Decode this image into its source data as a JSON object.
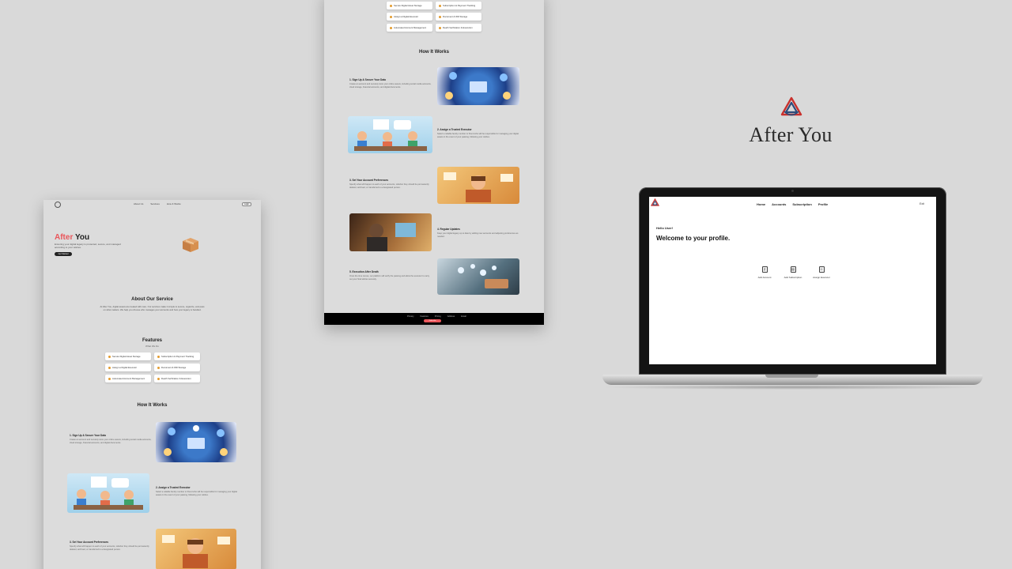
{
  "brand": {
    "name": "After You"
  },
  "site": {
    "nav": {
      "links": [
        "About Us",
        "Services",
        "How It Works"
      ],
      "button": "Login"
    },
    "hero": {
      "title_accent": "After",
      "title_rest": " You",
      "subtitle": "Ensuring your digital legacy is protected, secure, and managed according to your wishes.",
      "cta": "Get Started"
    },
    "about": {
      "title": "About Our Service",
      "text": "At After You, digital assets are treated with care. Our services make it simple to secure, organize, and pass on what matters. We help you choose who manages your accounts and how your legacy is handled."
    },
    "features": {
      "title": "Features",
      "subtitle": "What We Do",
      "items": [
        "Secure Digital Asset Storage",
        "Subscription & Payment Tracking",
        "Assign a Digital Executor",
        "Document & Will Storage",
        "Automated Account Management",
        "Death Verification & Execution"
      ]
    },
    "how": {
      "title": "How It Works",
      "steps": [
        {
          "title": "1. Sign Up & Secure Your Data",
          "desc": "Create an account and securely store your online assets, including social media accounts, cloud storage, financial accounts, and digital documents."
        },
        {
          "title": "2. Assign a Trusted Executor",
          "desc": "Select a reliable family member or friend who will be responsible for managing your digital assets in the event of your passing, following your wishes."
        },
        {
          "title": "3. Set Your Account Preferences",
          "desc": "Specify what will happen to each of your accounts, whether they should be permanently deleted, archived, or transferred to a designated person."
        },
        {
          "title": "4. Regular Updates",
          "desc": "Keep your digital legacy up to date by adding new accounts and adjusting preferences as needed."
        },
        {
          "title": "5. Execution After Death",
          "desc": "Once the time comes, our platform will verify the passing and allow the executor to carry out your final wishes securely."
        }
      ]
    },
    "footer": {
      "links": [
        "Privacy",
        "Features",
        "Pricing",
        "Address",
        "Email"
      ],
      "button": "Subscribe"
    }
  },
  "app": {
    "nav": [
      "Home",
      "Accounts",
      "Subscription",
      "Profile"
    ],
    "exit": "Exit",
    "hello": "Hello User!",
    "welcome": "Welcome to your profile.",
    "actions": [
      {
        "label": "Add Account",
        "icon": "key-icon"
      },
      {
        "label": "Add Subscription",
        "icon": "card-icon"
      },
      {
        "label": "Assign Executor",
        "icon": "user-icon"
      }
    ]
  },
  "colors": {
    "accent": "#e9565b",
    "background": "#d9d9d9",
    "laptop_bezel": "#141414"
  }
}
